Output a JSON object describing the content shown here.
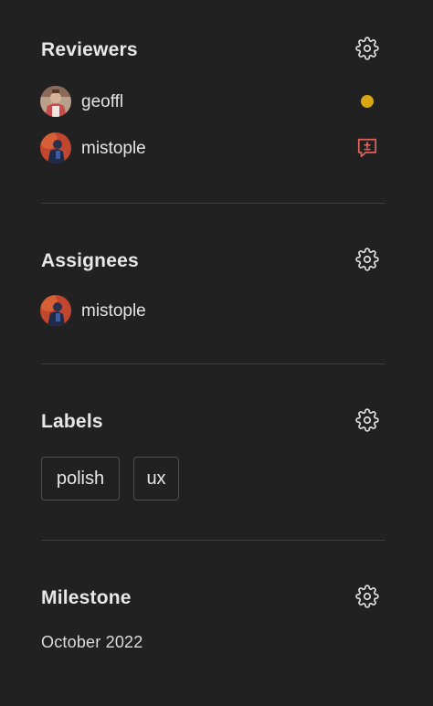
{
  "reviewers": {
    "title": "Reviewers",
    "settings_icon": "gear-icon",
    "people": [
      {
        "name": "geoffl",
        "status": "pending",
        "status_color": "#d8a712",
        "status_icon": "status-dot-icon"
      },
      {
        "name": "mistople",
        "status": "changes-requested",
        "status_color": "#e2625a",
        "status_icon": "comment-diff-icon"
      }
    ]
  },
  "assignees": {
    "title": "Assignees",
    "settings_icon": "gear-icon",
    "people": [
      {
        "name": "mistople"
      }
    ]
  },
  "labels": {
    "title": "Labels",
    "settings_icon": "gear-icon",
    "items": [
      "polish",
      "ux"
    ]
  },
  "milestone": {
    "title": "Milestone",
    "settings_icon": "gear-icon",
    "value": "October 2022"
  },
  "colors": {
    "background": "#212121",
    "text": "#e6e6e6",
    "divider": "#3d3d3d",
    "chip_border": "#4f4f4f",
    "pending": "#d8a712",
    "changes_requested": "#e2625a"
  }
}
